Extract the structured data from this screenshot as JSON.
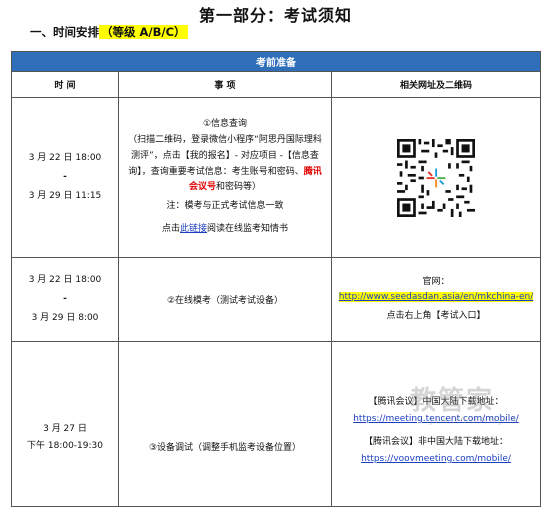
{
  "page_title": "第一部分：考试须知",
  "section": {
    "prefix": "一、时间安排",
    "level": "（等级 A/B/C）"
  },
  "table": {
    "banner": "考前准备",
    "headers": [
      "时 间",
      "事 项",
      "相关网址及二维码"
    ],
    "row1": {
      "time_start": "3 月 22 日 18:00",
      "time_dash": "-",
      "time_end": "3 月 29 日 11:15",
      "item_title": "①信息查询",
      "item_text1": "（扫描二维码，登录微信小程序“阿思丹国际理科测评”，点击【我的报名】- 对应项目 -【信息查询】，查询重要考试信息：考生账号和密码、",
      "item_red": "腾讯会议号",
      "item_text2": "和密码等）",
      "note": "注：模考与正式考试信息一致",
      "click_prefix": "点击",
      "link_text": "此链接",
      "click_suffix": "阅读在线监考知情书",
      "qr_icon": "qr-code-icon"
    },
    "row2": {
      "time_start": "3 月 22 日 18:00",
      "time_dash": "-",
      "time_end": "3 月 29 日 8:00",
      "item": "②在线模考（测试考试设备）",
      "site_label": "官网：",
      "url": "http://www.seedasdan.asia/en/mkchina-en/",
      "site_note": "点击右上角【考试入口】"
    },
    "row3": {
      "date": "3 月 27 日",
      "time": "下午 18:00-19:30",
      "item": "③设备调试（调整手机监考设备位置）",
      "label_cn": "【腾讯会议】中国大陆下载地址：",
      "url_cn": "https://meeting.tencent.com/mobile/",
      "label_intl": "【腾讯会议】非中国大陆下载地址：",
      "url_intl": "https://voovmeeting.com/mobile/"
    }
  },
  "watermark": {
    "big": "教管家",
    "small": "JIAOGUANJIA"
  },
  "colors": {
    "banner": "#2f6fba",
    "highlight": "#ffff00",
    "red": "#e00000",
    "link": "#1a3fc0"
  }
}
